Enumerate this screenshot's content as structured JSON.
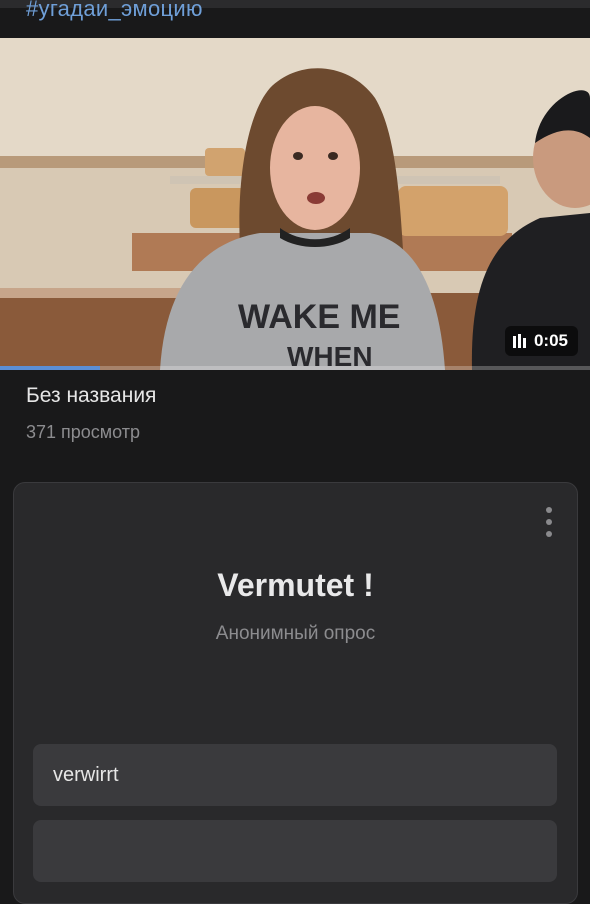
{
  "header": {
    "hashtag": "#угадаи_эмоцию"
  },
  "video": {
    "duration": "0:05",
    "progress_fraction": 0.17,
    "shirt_text_line1": "WAKE ME",
    "shirt_text_line2": "WHEN",
    "title": "Без названия",
    "views": "371 просмотр"
  },
  "poll": {
    "title": "Vermutet !",
    "subtitle": "Анонимный опрос",
    "options": [
      {
        "label": "verwirrt"
      },
      {
        "label": ""
      }
    ]
  },
  "colors": {
    "background": "#19191a",
    "card": "#29292b",
    "option": "#3a3a3d",
    "accent": "#6f9fd8"
  },
  "icons": {
    "duration": "equalizer-bars-icon",
    "menu": "vertical-dots-icon"
  }
}
